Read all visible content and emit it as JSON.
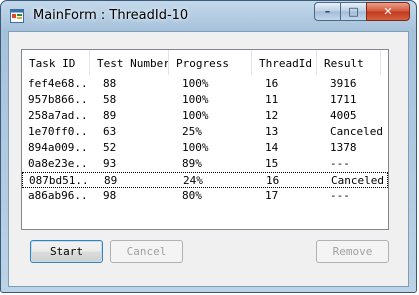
{
  "window": {
    "title": "MainForm : ThreadId-10",
    "minimize_glyph": "–",
    "maximize_glyph": "□",
    "close_glyph": "✕"
  },
  "tasks_list": {
    "columns": [
      "Task ID",
      "Test Number",
      "Progress",
      "ThreadId",
      "Result"
    ],
    "rows": [
      {
        "task_id": "fef4e68...",
        "test_number": "88",
        "progress": "100%",
        "thread_id": "16",
        "result": "3916"
      },
      {
        "task_id": "957b866...",
        "test_number": "58",
        "progress": "100%",
        "thread_id": "11",
        "result": "1711"
      },
      {
        "task_id": "258a7ad...",
        "test_number": "89",
        "progress": "100%",
        "thread_id": "12",
        "result": "4005"
      },
      {
        "task_id": "1e70ff0...",
        "test_number": "63",
        "progress": "25%",
        "thread_id": "13",
        "result": "Canceled"
      },
      {
        "task_id": "894a009...",
        "test_number": "52",
        "progress": "100%",
        "thread_id": "14",
        "result": "1378"
      },
      {
        "task_id": "0a8e23e...",
        "test_number": "93",
        "progress": "89%",
        "thread_id": "15",
        "result": "---"
      },
      {
        "task_id": "087bd51...",
        "test_number": "89",
        "progress": "24%",
        "thread_id": "16",
        "result": "Canceled"
      },
      {
        "task_id": "a86ab96...",
        "test_number": "98",
        "progress": "80%",
        "thread_id": "17",
        "result": "---"
      }
    ],
    "focused_row": 6
  },
  "buttons": {
    "start": "Start",
    "cancel": "Cancel",
    "remove": "Remove"
  },
  "colors": {
    "titlebar": "#a6c2db",
    "close_button": "#c03a20",
    "focus_border": "#3c7fb1"
  }
}
